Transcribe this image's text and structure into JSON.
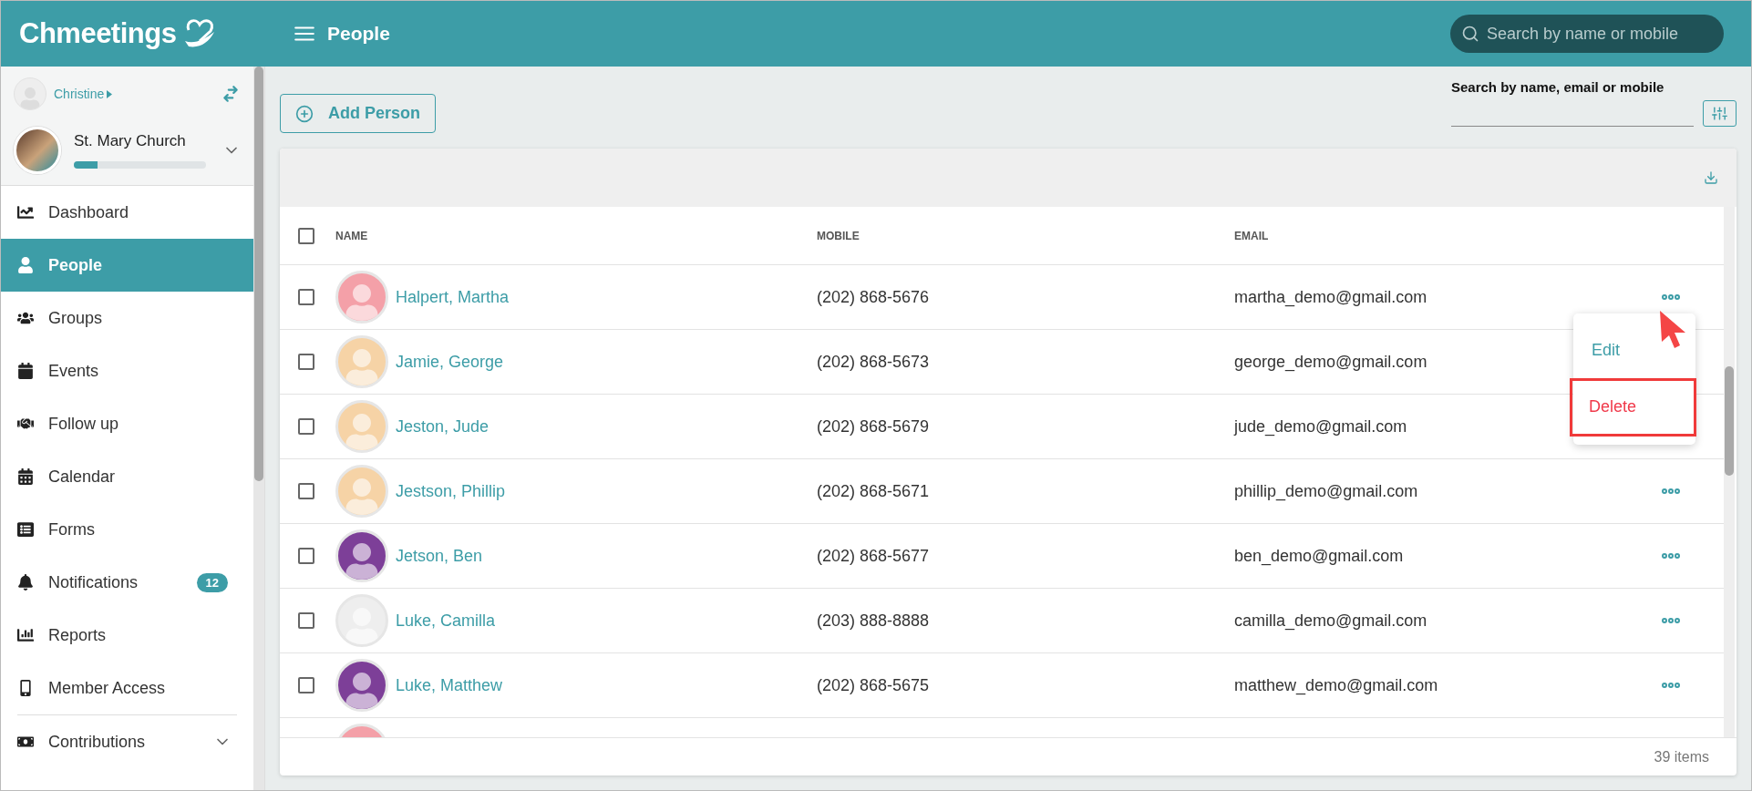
{
  "header": {
    "logo": "Chmeetings",
    "title": "People",
    "search": {
      "placeholder": "Search by name or mobile"
    }
  },
  "sidebar": {
    "user": {
      "name": "Christine"
    },
    "church": {
      "name": "St. Mary Church",
      "level": 0.18
    },
    "items": [
      {
        "label": "Dashboard",
        "selected": false
      },
      {
        "label": "People",
        "selected": true
      },
      {
        "label": "Groups",
        "selected": false
      },
      {
        "label": "Events",
        "selected": false
      },
      {
        "label": "Follow up",
        "selected": false
      },
      {
        "label": "Calendar",
        "selected": false
      },
      {
        "label": "Forms",
        "selected": false
      },
      {
        "label": "Notifications",
        "selected": false,
        "badge": "12"
      },
      {
        "label": "Reports",
        "selected": false
      },
      {
        "label": "Member Access",
        "selected": false
      },
      {
        "label": "Contributions",
        "selected": false,
        "expandable": true
      }
    ]
  },
  "toolbar": {
    "add_button": "Add Person",
    "search_label": "Search by name, email or mobile"
  },
  "table": {
    "columns": [
      "NAME",
      "MOBILE",
      "EMAIL"
    ],
    "rows": [
      {
        "name": "Halpert, Martha",
        "mobile": "(202) 868-5676",
        "email": "martha_demo@gmail.com",
        "color": "#f4a0a8",
        "checked": false
      },
      {
        "name": "Jamie, George",
        "mobile": "(202) 868-5673",
        "email": "george_demo@gmail.com",
        "color": "#f6d3a6",
        "checked": false
      },
      {
        "name": "Jeston, Jude",
        "mobile": "(202) 868-5679",
        "email": "jude_demo@gmail.com",
        "color": "#f6d3a6",
        "checked": false
      },
      {
        "name": "Jestson, Phillip",
        "mobile": "(202) 868-5671",
        "email": "phillip_demo@gmail.com",
        "color": "#f6d3a6",
        "checked": false
      },
      {
        "name": "Jetson, Ben",
        "mobile": "(202) 868-5677",
        "email": "ben_demo@gmail.com",
        "color": "#7d3f98",
        "checked": false
      },
      {
        "name": "Luke, Camilla",
        "mobile": "(203) 888-8888",
        "email": "camilla_demo@gmail.com",
        "color": "#eeeeee",
        "checked": false
      },
      {
        "name": "Luke, Matthew",
        "mobile": "(202) 868-5675",
        "email": "matthew_demo@gmail.com",
        "color": "#7d3f98",
        "checked": false
      },
      {
        "color": "#f4a0a8"
      }
    ],
    "select_all_checked": false,
    "footer": "39 items"
  },
  "row_menu": {
    "items": [
      {
        "label": "Edit",
        "kind": "edit"
      },
      {
        "label": "Delete",
        "kind": "delete"
      }
    ]
  }
}
